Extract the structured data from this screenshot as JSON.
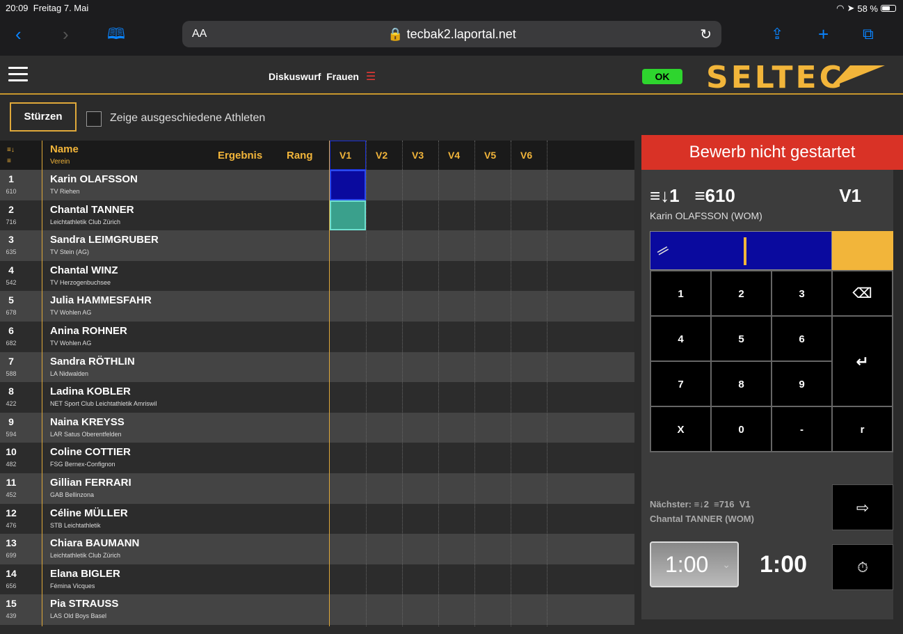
{
  "status_bar": {
    "time": "20:09",
    "date": "Freitag 7. Mai",
    "battery": "58 %"
  },
  "browser": {
    "text_size": "AA",
    "url": "tecbak2.laportal.net"
  },
  "header": {
    "discipline": "Diskuswurf",
    "category": "Frauen",
    "ok": "OK",
    "logo": "SELTEC"
  },
  "toolbar": {
    "sturzen": "Stürzen",
    "show_eliminated": "Zeige ausgeschiedene Athleten"
  },
  "table": {
    "headers": {
      "name": "Name",
      "club": "Verein",
      "result": "Ergebnis",
      "rank": "Rang"
    },
    "attempts": [
      "V1",
      "V2",
      "V3",
      "V4",
      "V5",
      "V6"
    ],
    "rows": [
      {
        "order": "1",
        "bib": "610",
        "name": "Karin OLAFSSON",
        "club": "TV Riehen"
      },
      {
        "order": "2",
        "bib": "716",
        "name": "Chantal TANNER",
        "club": "Leichtathletik Club Zürich"
      },
      {
        "order": "3",
        "bib": "635",
        "name": "Sandra LEIMGRUBER",
        "club": "TV Stein (AG)"
      },
      {
        "order": "4",
        "bib": "542",
        "name": "Chantal WINZ",
        "club": "TV Herzogenbuchsee"
      },
      {
        "order": "5",
        "bib": "678",
        "name": "Julia HAMMESFAHR",
        "club": "TV Wohlen AG"
      },
      {
        "order": "6",
        "bib": "682",
        "name": "Anina ROHNER",
        "club": "TV Wohlen AG"
      },
      {
        "order": "7",
        "bib": "588",
        "name": "Sandra RÖTHLIN",
        "club": "LA Nidwalden"
      },
      {
        "order": "8",
        "bib": "422",
        "name": "Ladina KOBLER",
        "club": "NET Sport Club Leichtathletik Amriswil"
      },
      {
        "order": "9",
        "bib": "594",
        "name": "Naina KREYSS",
        "club": "LAR Satus Oberentfelden"
      },
      {
        "order": "10",
        "bib": "482",
        "name": "Coline COTTIER",
        "club": "FSG Bernex-Confignon"
      },
      {
        "order": "11",
        "bib": "452",
        "name": "Gillian FERRARI",
        "club": "GAB Bellinzona"
      },
      {
        "order": "12",
        "bib": "476",
        "name": "Céline MÜLLER",
        "club": "STB Leichtathletik"
      },
      {
        "order": "13",
        "bib": "699",
        "name": "Chiara BAUMANN",
        "club": "Leichtathletik Club Zürich"
      },
      {
        "order": "14",
        "bib": "656",
        "name": "Elana BIGLER",
        "club": "Fémina Vicques"
      },
      {
        "order": "15",
        "bib": "439",
        "name": "Pia STRAUSS",
        "club": "LAS Old Boys Basel"
      }
    ]
  },
  "panel": {
    "banner": "Bewerb nicht gestartet",
    "current": {
      "order": "1",
      "bib": "610",
      "attempt": "V1",
      "name": "Karin OLAFSSON (WOM)"
    },
    "keys": [
      "1",
      "2",
      "3",
      "4",
      "5",
      "6",
      "7",
      "8",
      "9",
      "X",
      "0",
      "-",
      "r"
    ],
    "next_label": "Nächster:",
    "next": {
      "order": "2",
      "bib": "716",
      "attempt": "V1",
      "name": "Chantal TANNER (WOM)"
    },
    "timer_select": "1:00",
    "timer": "1:00"
  },
  "colors": {
    "accent": "#f2b53a",
    "banner": "#d93226",
    "ok": "#2ed52e",
    "current_cell": "#0a0a9e",
    "next_cell": "#3aa08c"
  }
}
